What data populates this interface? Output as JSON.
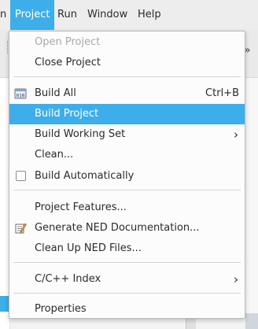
{
  "menubar": {
    "items": [
      {
        "label": "n"
      },
      {
        "label": "Project"
      },
      {
        "label": "Run"
      },
      {
        "label": "Window"
      },
      {
        "label": "Help"
      }
    ]
  },
  "menu": {
    "open_project": "Open Project",
    "close_project": "Close Project",
    "build_all": "Build All",
    "build_all_shortcut": "Ctrl+B",
    "build_project": "Build Project",
    "build_working_set": "Build Working Set",
    "clean": "Clean...",
    "build_automatically": "Build Automatically",
    "project_features": "Project Features...",
    "generate_ned_docs": "Generate NED Documentation...",
    "clean_up_ned": "Clean Up NED Files...",
    "cpp_index": "C/C++ Index",
    "properties": "Properties",
    "submenu_arrow": "›"
  },
  "icons": {
    "build_all": "build-binary-icon",
    "build_automatically": "checkbox-unchecked",
    "generate_ned_docs": "documentation-icon"
  },
  "colors": {
    "accent": "#3daee9",
    "disabled_text": "#a9a9a9",
    "menu_background": "#fcfcfc"
  },
  "toolbar": {
    "overflow_glyph": "»"
  }
}
